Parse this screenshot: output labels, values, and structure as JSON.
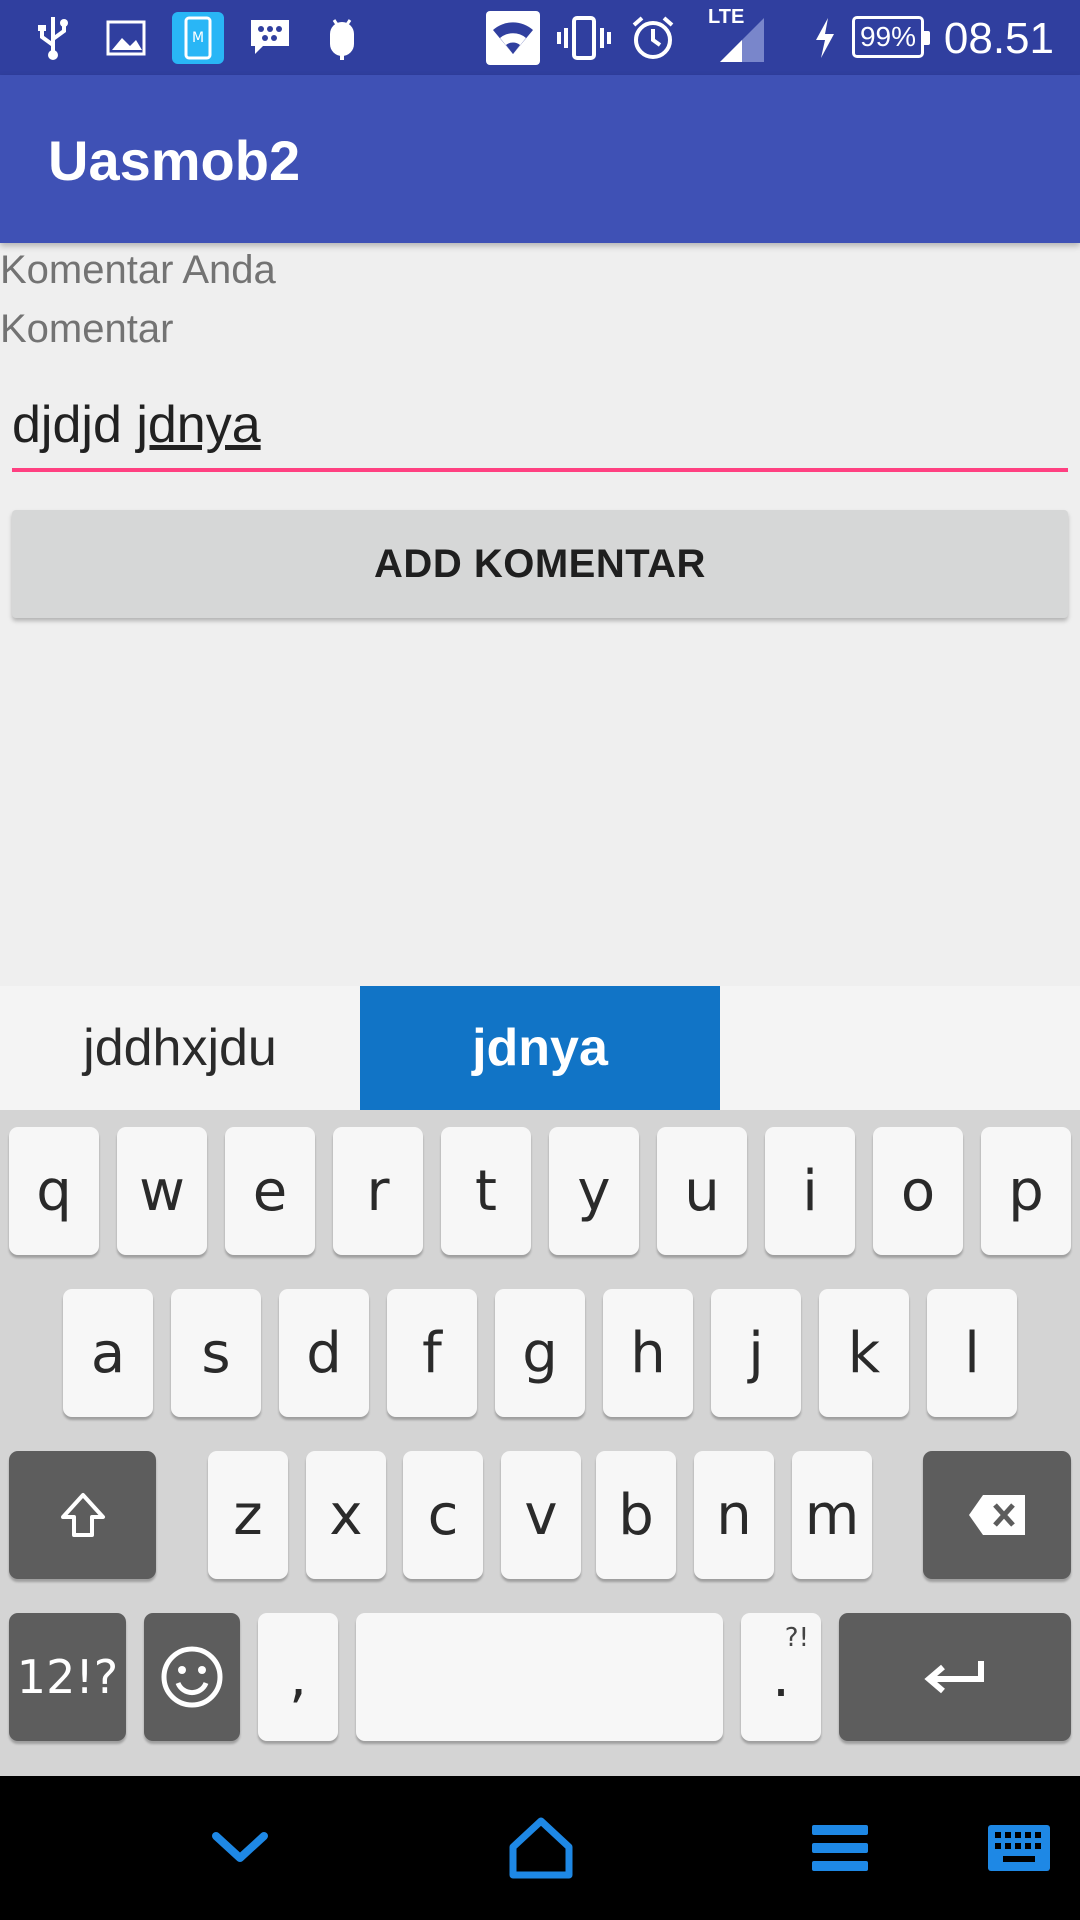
{
  "status_bar": {
    "time": "08.51",
    "battery": "99%",
    "network": "LTE",
    "icons": [
      "usb-icon",
      "gallery-icon",
      "phone-sync-icon",
      "bbm-icon",
      "android-debug-icon",
      "wifi-icon",
      "vibrate-icon",
      "alarm-icon",
      "signal-icon",
      "charging-icon"
    ]
  },
  "app_bar": {
    "title": "Uasmob2"
  },
  "form": {
    "heading": "Komentar Anda",
    "field_label": "Komentar",
    "input_prefix": "djdjd ",
    "input_underlined": "jdnya",
    "button_label": "ADD KOMENTAR"
  },
  "suggestions": [
    {
      "text": "jddhxjdu",
      "active": false
    },
    {
      "text": "jdnya",
      "active": true
    },
    {
      "text": "",
      "active": false
    }
  ],
  "keyboard": {
    "row1": [
      "q",
      "w",
      "e",
      "r",
      "t",
      "y",
      "u",
      "i",
      "o",
      "p"
    ],
    "row2": [
      "a",
      "s",
      "d",
      "f",
      "g",
      "h",
      "j",
      "k",
      "l"
    ],
    "row3": [
      "z",
      "x",
      "c",
      "v",
      "b",
      "n",
      "m"
    ],
    "symbols_label": "12!?",
    "comma": ",",
    "period": ".",
    "period_sub": "?!"
  },
  "colors": {
    "status_bar": "#303f9f",
    "app_bar": "#3f51b5",
    "accent": "#ff4081",
    "suggestion_active": "#1174c6",
    "nav_glow": "#1e88e5"
  }
}
